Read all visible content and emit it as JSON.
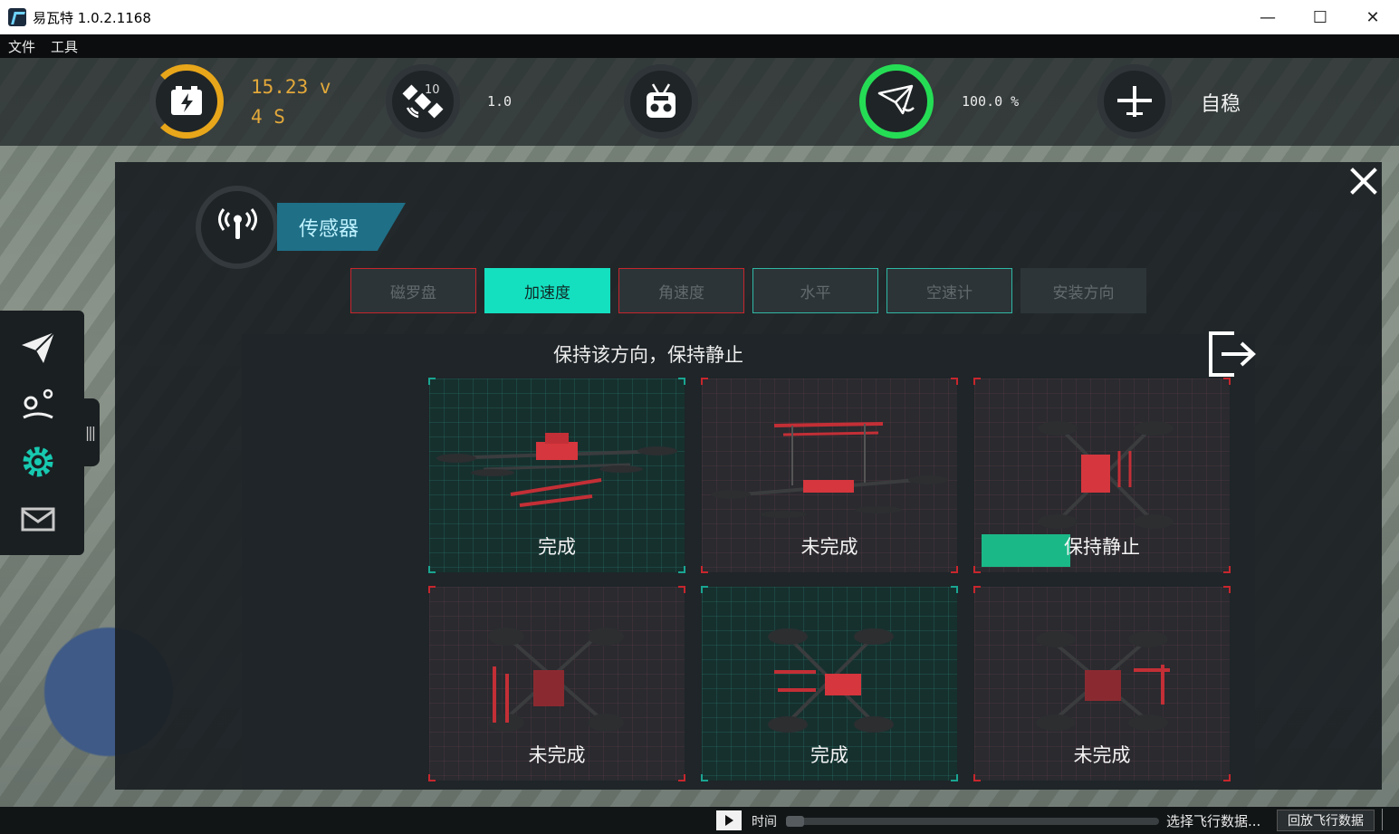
{
  "window": {
    "title": "易瓦特 1.0.2.1168",
    "minimize": "—",
    "maximize": "☐",
    "close": "✕"
  },
  "menu": [
    "文件",
    "工具"
  ],
  "status": {
    "battery_voltage": "15.23 v",
    "battery_cells": "4 S",
    "gps_satellites": "10",
    "gps_value": "1.0",
    "signal_value": "100.0 %",
    "flight_mode": "自稳"
  },
  "panel": {
    "section_title": "传感器",
    "tabs": [
      {
        "label": "磁罗盘",
        "state": "error"
      },
      {
        "label": "加速度",
        "state": "active"
      },
      {
        "label": "角速度",
        "state": "error"
      },
      {
        "label": "水平",
        "state": "ok"
      },
      {
        "label": "空速计",
        "state": "ok"
      },
      {
        "label": "安装方向",
        "state": "disabled"
      }
    ],
    "instruction": "保持该方向，保持静止",
    "cards": [
      {
        "label": "完成",
        "status": "done"
      },
      {
        "label": "未完成",
        "status": "undone"
      },
      {
        "label": "保持静止",
        "status": "in-progress",
        "progress": 0.35
      },
      {
        "label": "未完成",
        "status": "undone"
      },
      {
        "label": "完成",
        "status": "done"
      },
      {
        "label": "未完成",
        "status": "undone"
      }
    ]
  },
  "bottom": {
    "time_label": "时间",
    "select_data": "选择飞行数据...",
    "replay_button": "回放飞行数据"
  },
  "colors": {
    "accent": "#14e0c0",
    "error": "#c7262d",
    "battery": "#e8a61a",
    "signal": "#25dd55"
  }
}
